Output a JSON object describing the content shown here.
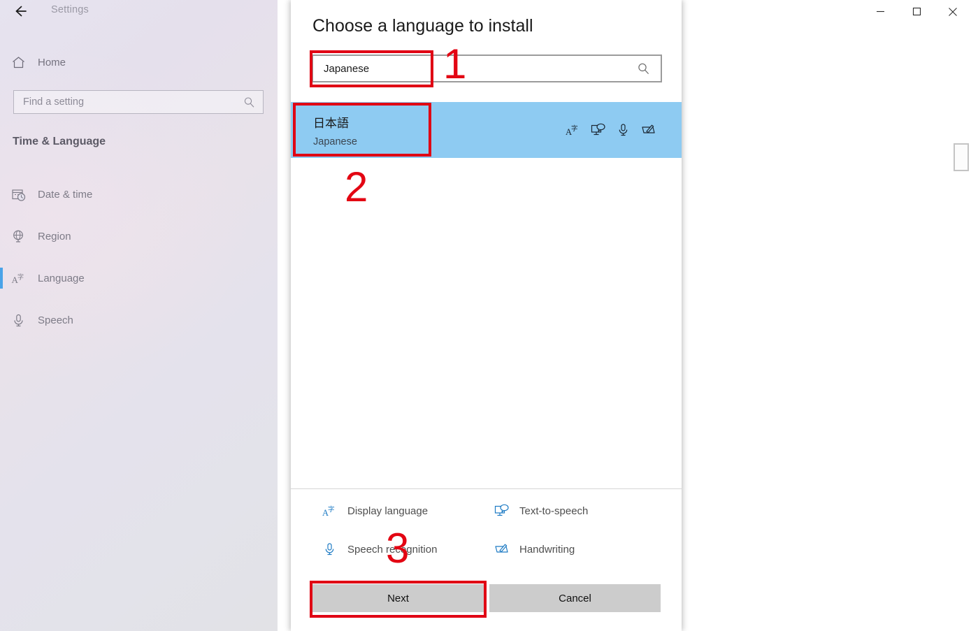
{
  "window": {
    "title": "Settings",
    "back_icon": "back-arrow-icon",
    "controls": {
      "minimize": "minimize-icon",
      "maximize": "maximize-icon",
      "close": "close-icon"
    }
  },
  "sidebar": {
    "home": {
      "label": "Home",
      "icon": "home-icon"
    },
    "search": {
      "placeholder": "Find a setting",
      "icon": "search-icon"
    },
    "section_header": "Time & Language",
    "items": [
      {
        "label": "Date & time",
        "icon": "calendar-clock-icon",
        "selected": false
      },
      {
        "label": "Region",
        "icon": "globe-icon",
        "selected": false
      },
      {
        "label": "Language",
        "icon": "language-icon",
        "selected": true
      },
      {
        "label": "Speech",
        "icon": "microphone-icon",
        "selected": false
      }
    ],
    "accent_color": "#4aa3e8"
  },
  "dialog": {
    "title": "Choose a language to install",
    "search": {
      "value": "Japanese",
      "placeholder": "",
      "icon": "search-icon"
    },
    "results": [
      {
        "native_name": "日本語",
        "english_name": "Japanese",
        "selected": true,
        "capabilities": [
          "display-language-icon",
          "text-to-speech-icon",
          "speech-recognition-icon",
          "handwriting-icon"
        ]
      }
    ],
    "selected_row_color": "#8ecbf2",
    "legend": [
      {
        "label": "Display language",
        "icon": "display-language-icon"
      },
      {
        "label": "Text-to-speech",
        "icon": "text-to-speech-icon"
      },
      {
        "label": "Speech recognition",
        "icon": "speech-recognition-icon"
      },
      {
        "label": "Handwriting",
        "icon": "handwriting-icon"
      }
    ],
    "legend_icon_color": "#1e7bc4",
    "buttons": {
      "next": "Next",
      "cancel": "Cancel"
    }
  },
  "annotations": {
    "color": "#e30613",
    "steps": [
      {
        "number": "1",
        "target": "search-field"
      },
      {
        "number": "2",
        "target": "japanese-result-row"
      },
      {
        "number": "3",
        "target": "next-button"
      }
    ]
  }
}
